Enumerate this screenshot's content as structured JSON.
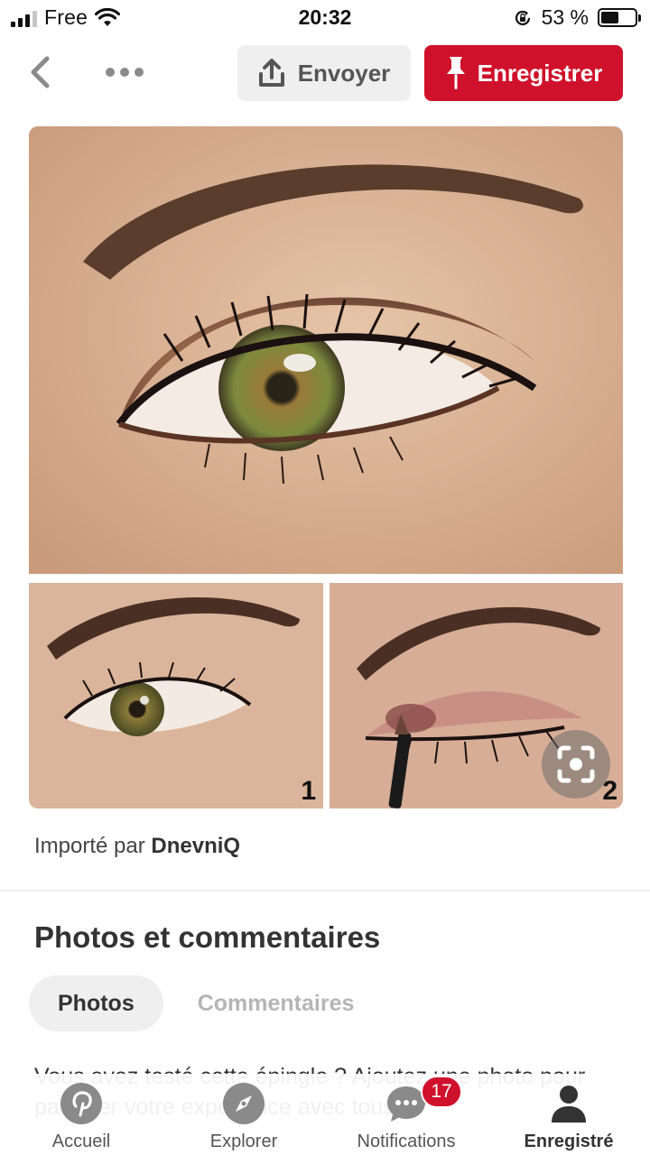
{
  "status_bar": {
    "carrier": "Free",
    "time": "20:32",
    "battery_percent": "53 %",
    "battery_level": 0.53
  },
  "top_bar": {
    "send_label": "Envoyer",
    "save_label": "Enregistrer"
  },
  "pin": {
    "step_1": "1",
    "step_2": "2",
    "imported_prefix": "Importé par",
    "imported_user": "DnevniQ"
  },
  "section": {
    "title": "Photos et commentaires",
    "tabs": [
      {
        "label": "Photos",
        "selected": true
      },
      {
        "label": "Commentaires",
        "selected": false
      }
    ],
    "prompt": "Vous avez testé cette épingle ? Ajoutez une photo pour partager votre expérience avec tous."
  },
  "bottom_nav": {
    "items": [
      {
        "label": "Accueil",
        "icon": "pinterest-logo-icon"
      },
      {
        "label": "Explorer",
        "icon": "compass-icon"
      },
      {
        "label": "Notifications",
        "icon": "speech-bubble-icon",
        "badge": "17"
      },
      {
        "label": "Enregistré",
        "icon": "profile-icon",
        "active": true
      }
    ]
  },
  "colors": {
    "accent": "#d0112b",
    "secondary_button": "#efefef"
  }
}
